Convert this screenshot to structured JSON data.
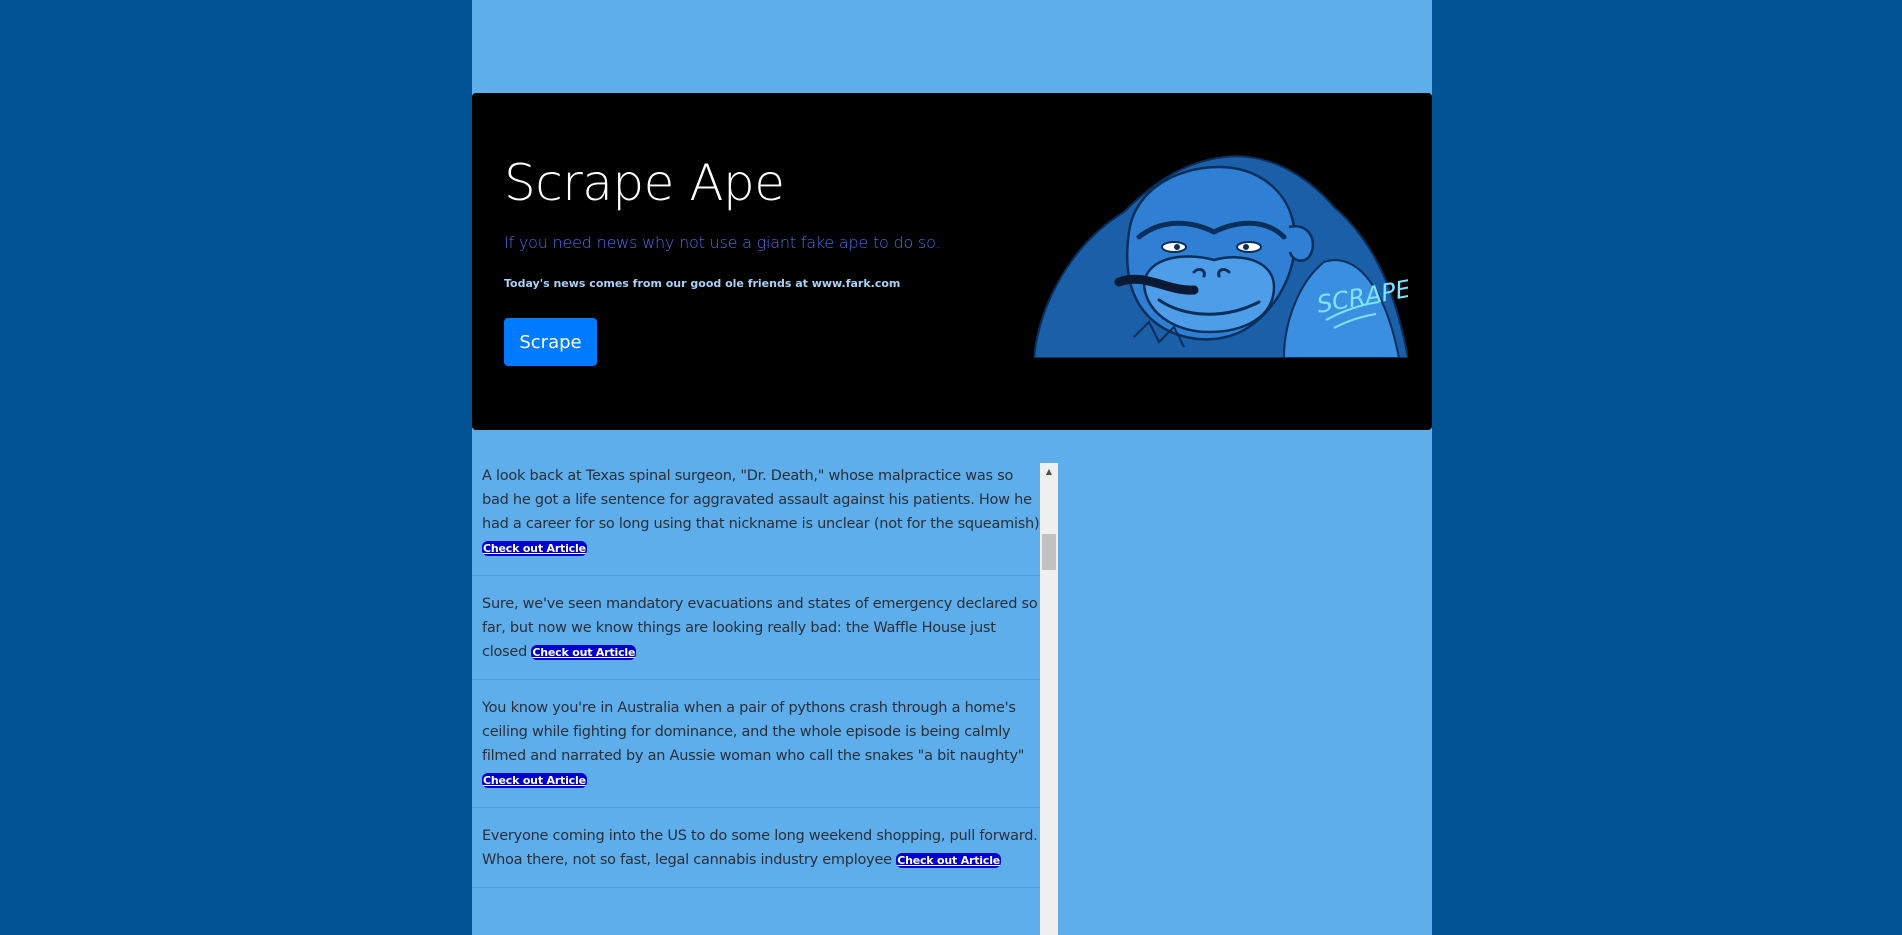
{
  "header": {
    "title": "Scrape Ape",
    "subtitle": "If you need news why not use a giant fake ape to do so.",
    "source_note": "Today's news comes from our good ole friends at www.fark.com",
    "scrape_button": "Scrape",
    "logo_text": "SCRAPE",
    "logo_icon": "gorilla-logo"
  },
  "news": {
    "link_label": "Check out Article",
    "items": [
      {
        "text": "A look back at Texas spinal surgeon, \"Dr. Death,\" whose malpractice was so bad he got a life sentence for aggravated assault against his patients. How he had a career for so long using that nickname is unclear (not for the squeamish)"
      },
      {
        "text": "Sure, we've seen mandatory evacuations and states of emergency declared so far, but now we know things are looking really bad: the Waffle House just closed"
      },
      {
        "text": "You know you're in Australia when a pair of pythons crash through a home's ceiling while fighting for dominance, and the whole episode is being calmly filmed and narrated by an Aussie woman who call the snakes \"a bit naughty\""
      },
      {
        "text": "Everyone coming into the US to do some long weekend shopping, pull forward. Whoa there, not so fast, legal cannabis industry employee"
      }
    ]
  },
  "colors": {
    "page_bg": "#005494",
    "container_bg": "#5daeea",
    "jumbotron_bg": "#000000",
    "button_bg": "#007bff",
    "link_bg": "#0000cc",
    "subtitle": "#4e6cf2"
  }
}
